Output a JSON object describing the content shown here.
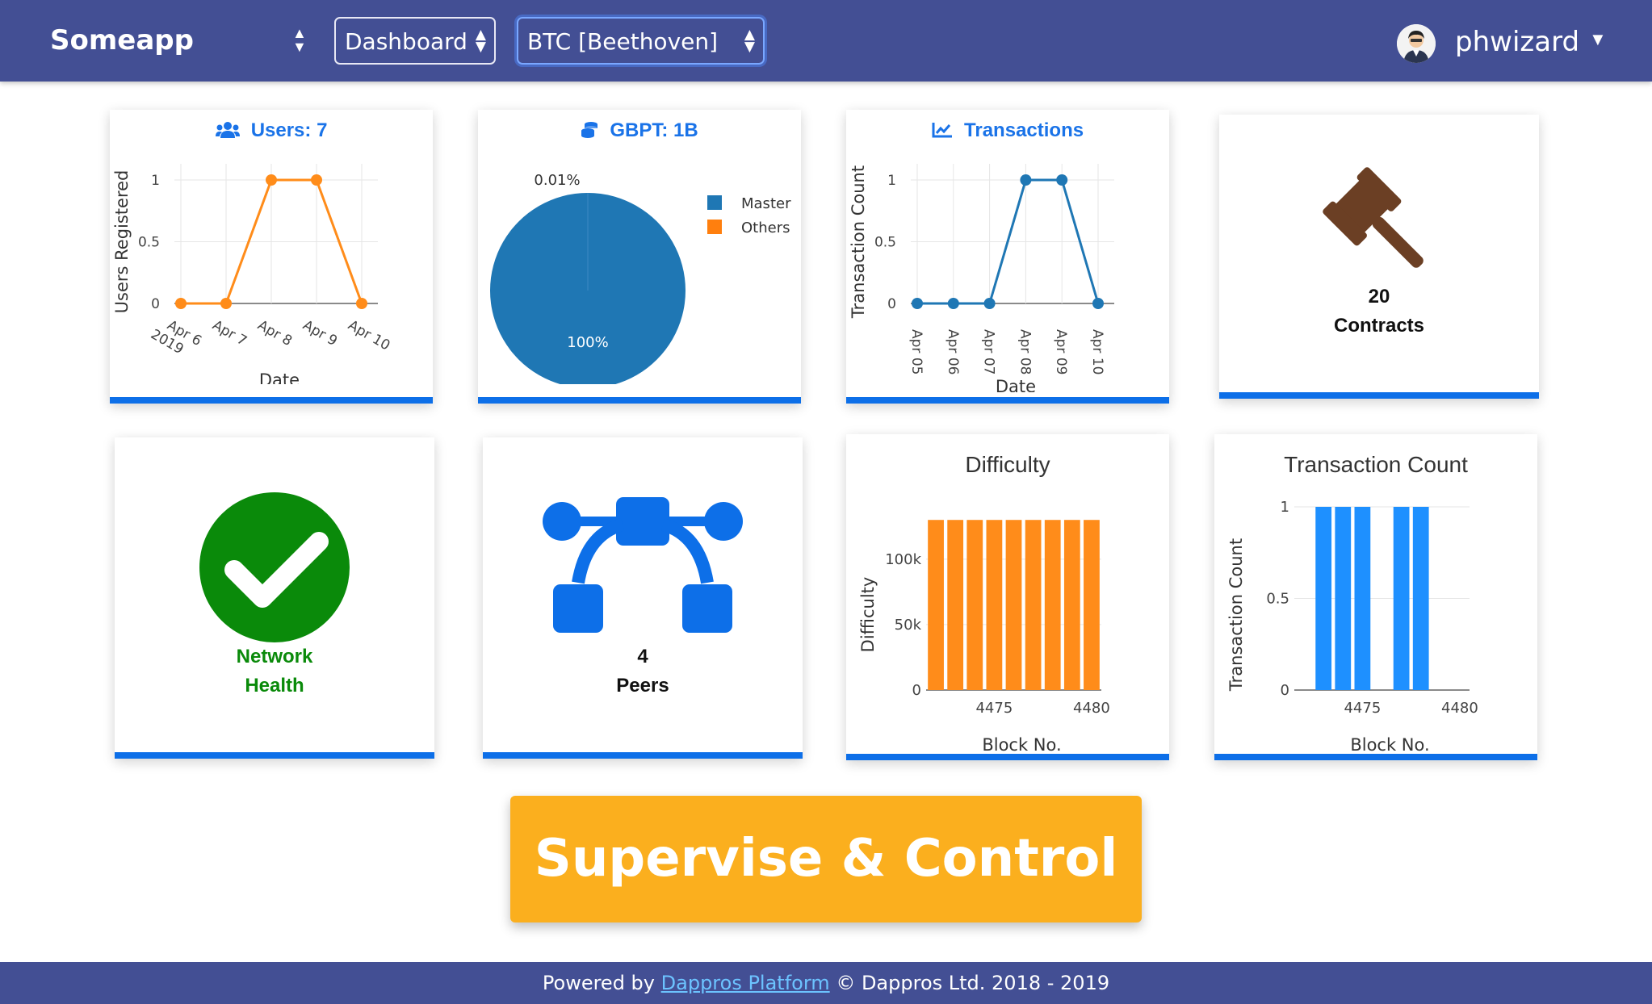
{
  "header": {
    "brand": "Someapp",
    "page_select": "Dashboard",
    "network_select": "BTC [Beethoven]",
    "username": "phwizard"
  },
  "cards": {
    "users": {
      "title": "Users: 7"
    },
    "token": {
      "title": "GBPT: 1B"
    },
    "transactions": {
      "title": "Transactions"
    },
    "contracts": {
      "count": "20",
      "label": "Contracts"
    },
    "network": {
      "label_line1": "Network",
      "label_line2": "Health"
    },
    "peers": {
      "count": "4",
      "label": "Peers"
    },
    "difficulty": {
      "title": "Difficulty"
    },
    "tx_count": {
      "title": "Transaction Count"
    }
  },
  "chart_data": [
    {
      "type": "line",
      "x": [
        "Apr 6\n2019",
        "Apr 7",
        "Apr 8",
        "Apr 9",
        "Apr 10"
      ],
      "series": [
        {
          "values": [
            0,
            0,
            1,
            1,
            0
          ],
          "color": "#ff8c1a"
        }
      ],
      "xlabel": "Date",
      "ylabel": "Users Registered",
      "yticks": [
        "0",
        "0.5",
        "1"
      ],
      "ylim": [
        0,
        1
      ],
      "grid": true
    },
    {
      "type": "pie",
      "slices": [
        {
          "name": "Master",
          "value": 99.99,
          "label": "100%",
          "color": "#1f77b4"
        },
        {
          "name": "Others",
          "value": 0.01,
          "label": "0.01%",
          "color": "#ff7f0e"
        }
      ],
      "legend": "right"
    },
    {
      "type": "line",
      "x": [
        "Apr 05",
        "Apr 06",
        "Apr 07",
        "Apr 08",
        "Apr 09",
        "Apr 10"
      ],
      "series": [
        {
          "values": [
            0,
            0,
            0,
            1,
            1,
            0
          ],
          "color": "#1f77b4"
        }
      ],
      "xlabel": "Date",
      "ylabel": "Transaction Count",
      "yticks": [
        "0",
        "0.5",
        "1"
      ],
      "ylim": [
        0,
        1
      ],
      "grid": true
    },
    {
      "type": "bar",
      "x": [
        4472,
        4473,
        4474,
        4475,
        4476,
        4477,
        4478,
        4479,
        4480
      ],
      "values": [
        130000,
        130000,
        130000,
        130000,
        130000,
        130000,
        130000,
        130000,
        130000
      ],
      "color": "#ff8c1a",
      "title": "Difficulty",
      "xlabel": "Block No.",
      "ylabel": "Difficulty",
      "xticks": [
        "4475",
        "4480"
      ],
      "yticks": [
        "0",
        "50k",
        "100k"
      ],
      "ylim": [
        0,
        140000
      ]
    },
    {
      "type": "bar",
      "x": [
        4473,
        4474,
        4475,
        4477,
        4478
      ],
      "values": [
        1,
        1,
        1,
        1,
        1
      ],
      "color": "#1e90ff",
      "title": "Transaction Count",
      "xlabel": "Block No.",
      "ylabel": "Transaction Count",
      "xticks": [
        "4475",
        "4480"
      ],
      "yticks": [
        "0",
        "0.5",
        "1"
      ],
      "ylim": [
        0,
        1
      ]
    }
  ],
  "cta": {
    "label": "Supervise & Control"
  },
  "footer": {
    "prefix": "Powered by",
    "link": "Dappros Platform",
    "suffix": "© Dappros Ltd. 2018 - 2019"
  },
  "colors": {
    "navbar": "#434f94",
    "accent": "#0d6fe8",
    "cta": "#fbaf1e",
    "health": "#0a8a0a"
  }
}
